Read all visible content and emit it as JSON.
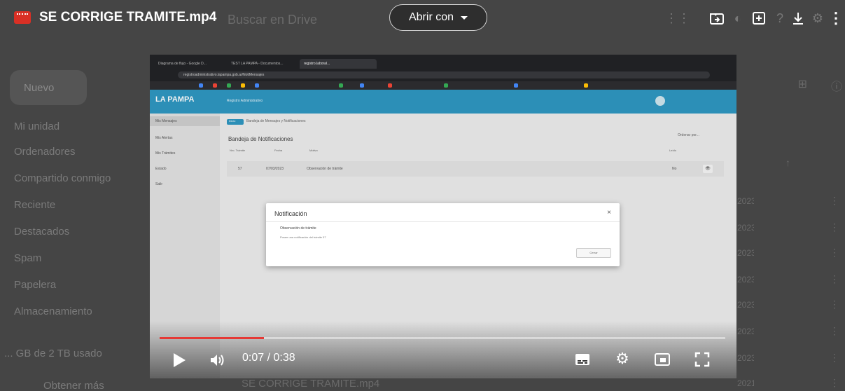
{
  "viewer": {
    "file_title": "SE CORRIGE TRAMITE.mp4",
    "open_with_label": "Abrir con",
    "search_placeholder": "Buscar en Drive"
  },
  "drive_sidebar": {
    "new_label": "Nuevo",
    "items": [
      "Mi unidad",
      "Ordenadores",
      "Compartido conmigo",
      "Reciente",
      "Destacados",
      "Spam",
      "Papelera",
      "Almacenamiento"
    ],
    "storage_text": "... GB de 2 TB usado",
    "buy_storage": "Obtener más"
  },
  "drive_list": {
    "dates": [
      "2023",
      "2023",
      "2023",
      "2023",
      "2023",
      "2023",
      "2023",
      "2021"
    ],
    "bottom_file": "SE CORRIGE TRAMITE.mp4"
  },
  "video_content": {
    "tabs": [
      "Diagrama de flujo - Google D...",
      "TEST LA PAMPA - Documentos...",
      "registro.laboral..."
    ],
    "url": "registroadministrativo.lapampa.gob.ar/NotiMensajes",
    "app": {
      "logo": "LA PAMPA",
      "header_title": "Registro Administrativo",
      "sidebar": [
        "Mis Mensajes",
        "Mis Alertas",
        "Mis Trámites",
        "Estado",
        "Salir"
      ],
      "breadcrumb_chip": "Inicio",
      "breadcrumb": "Bandeja de Mensajes y Notificaciones",
      "page_title": "Bandeja de Notificaciones",
      "link_right": "Ordenar por... ",
      "columns": [
        "Nro. Trámite",
        "Fecha",
        "Motivo",
        "Leído"
      ],
      "row": {
        "tramite": "57",
        "fecha": "07/03/2023",
        "motivo": "Observación de trámite",
        "leido": "No"
      }
    },
    "modal": {
      "title": "Notificación",
      "close": "×",
      "subtitle": "Observación de trámite",
      "message": "Posee una notificación del trámite 57",
      "button": "Cerrar"
    }
  },
  "player": {
    "current": "0:07",
    "duration": "0:38",
    "time_display": "0:07 / 0:38",
    "progress_fraction": 0.184
  },
  "colors": {
    "progress": "#e53935",
    "header_blue": "#2f97c1",
    "file_icon": "#d93025"
  }
}
